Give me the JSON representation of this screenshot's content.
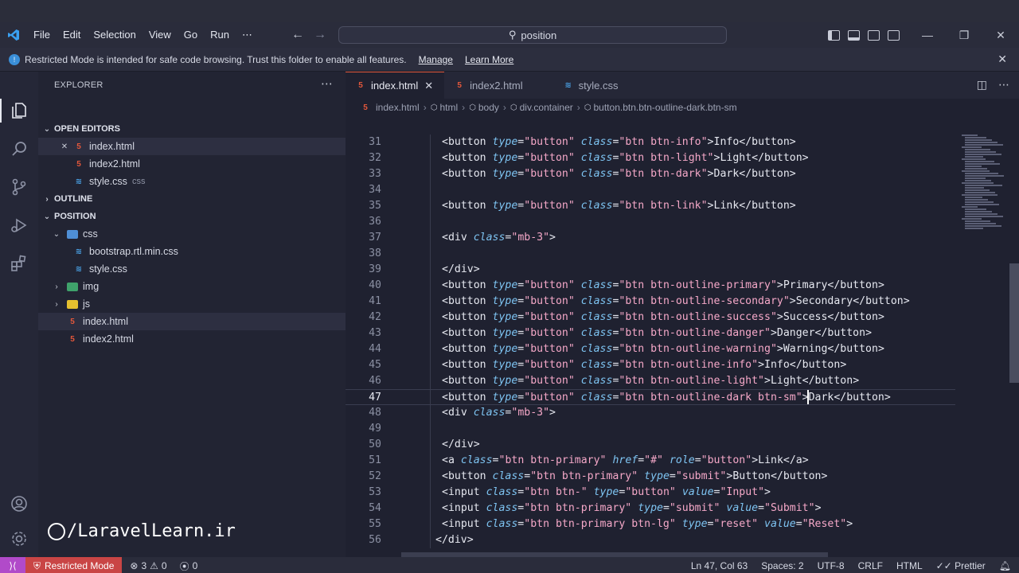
{
  "menu": [
    "File",
    "Edit",
    "Selection",
    "View",
    "Go",
    "Run",
    "⋯"
  ],
  "command_center": "position",
  "banner": {
    "text": "Restricted Mode is intended for safe code browsing. Trust this folder to enable all features.",
    "manage": "Manage",
    "learn_more": "Learn More"
  },
  "sidebar": {
    "title": "EXPLORER",
    "open_editors": "OPEN EDITORS",
    "open_files": [
      {
        "name": "index.html",
        "desc": ""
      },
      {
        "name": "index2.html",
        "desc": ""
      },
      {
        "name": "style.css",
        "desc": "css"
      }
    ],
    "outline": "OUTLINE",
    "project": "POSITION",
    "tree": {
      "css": "css",
      "bootstrap": "bootstrap.rtl.min.css",
      "style": "style.css",
      "img": "img",
      "js": "js",
      "index": "index.html",
      "index2": "index2.html"
    }
  },
  "watermark": "/LaravelLearn.ir",
  "tabs": [
    "index.html",
    "index2.html",
    "style.css"
  ],
  "breadcrumb": [
    "index.html",
    "html",
    "body",
    "div.container",
    "button.btn.btn-outline-dark.btn-sm"
  ],
  "code_lines": [
    {
      "n": "31",
      "html": "<button type=\"button\" class=\"btn btn-info\">Info</button>"
    },
    {
      "n": "32",
      "html": "<button type=\"button\" class=\"btn btn-light\">Light</button>"
    },
    {
      "n": "33",
      "html": "<button type=\"button\" class=\"btn btn-dark\">Dark</button>"
    },
    {
      "n": "34",
      "html": ""
    },
    {
      "n": "35",
      "html": "<button type=\"button\" class=\"btn btn-link\">Link</button>"
    },
    {
      "n": "36",
      "html": ""
    },
    {
      "n": "37",
      "html": "<div class=\"mb-3\">"
    },
    {
      "n": "38",
      "html": ""
    },
    {
      "n": "39",
      "html": "</div>"
    },
    {
      "n": "40",
      "html": "<button type=\"button\" class=\"btn btn-outline-primary\">Primary</button>"
    },
    {
      "n": "41",
      "html": "<button type=\"button\" class=\"btn btn-outline-secondary\">Secondary</button>"
    },
    {
      "n": "42",
      "html": "<button type=\"button\" class=\"btn btn-outline-success\">Success</button>"
    },
    {
      "n": "43",
      "html": "<button type=\"button\" class=\"btn btn-outline-danger\">Danger</button>"
    },
    {
      "n": "44",
      "html": "<button type=\"button\" class=\"btn btn-outline-warning\">Warning</button>"
    },
    {
      "n": "45",
      "html": "<button type=\"button\" class=\"btn btn-outline-info\">Info</button>"
    },
    {
      "n": "46",
      "html": "<button type=\"button\" class=\"btn btn-outline-light\">Light</button>"
    },
    {
      "n": "47",
      "html": "<button type=\"button\" class=\"btn btn-outline-dark btn-sm\">Dark</button>"
    },
    {
      "n": "48",
      "html": "<div class=\"mb-3\">"
    },
    {
      "n": "49",
      "html": ""
    },
    {
      "n": "50",
      "html": "</div>"
    },
    {
      "n": "51",
      "html": "<a class=\"btn btn-primary\" href=\"#\" role=\"button\">Link</a>"
    },
    {
      "n": "52",
      "html": "<button class=\"btn btn-primary\" type=\"submit\">Button</button>"
    },
    {
      "n": "53",
      "html": "<input class=\"btn btn-\" type=\"button\" value=\"Input\">"
    },
    {
      "n": "54",
      "html": "<input class=\"btn btn-primary\" type=\"submit\" value=\"Submit\">"
    },
    {
      "n": "55",
      "html": "<input class=\"btn btn-primary btn-lg\" type=\"reset\" value=\"Reset\">"
    },
    {
      "n": "56",
      "html": "</div>"
    }
  ],
  "status": {
    "restricted": "Restricted Mode",
    "errors": "3",
    "warnings": "0",
    "ports": "0",
    "position": "Ln 47, Col 63",
    "spaces": "Spaces: 2",
    "encoding": "UTF-8",
    "eol": "CRLF",
    "language": "HTML",
    "formatter": "Prettier"
  },
  "colors": {
    "accent_html": "#e3573b",
    "accent_css": "#4aa3e8",
    "restricted_bg": "#c94545",
    "remote_bg": "#b14ac9"
  }
}
